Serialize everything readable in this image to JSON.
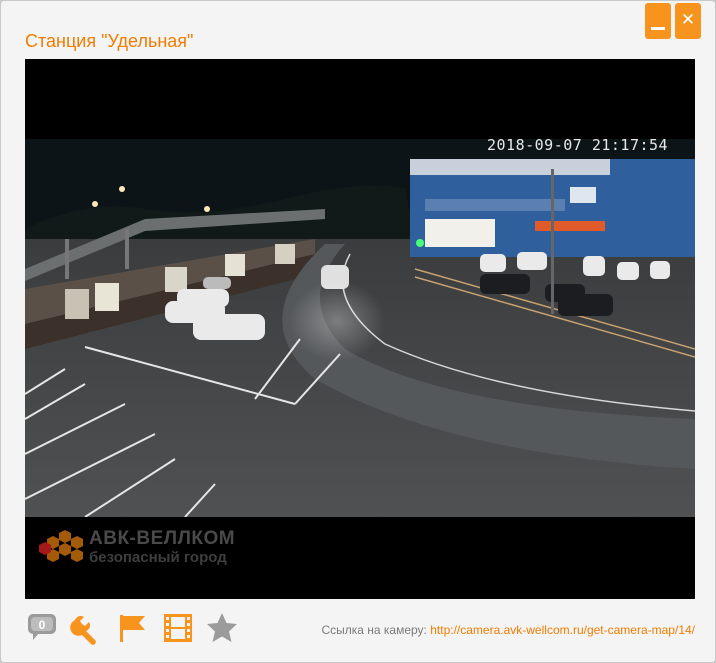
{
  "window": {
    "title": "Станция \"Удельная\"",
    "accent_color": "#f7941d",
    "title_color": "#f07c00",
    "buttons": [
      {
        "name": "minimize-icon"
      },
      {
        "name": "close-icon",
        "glyph": "✕"
      }
    ]
  },
  "video": {
    "timestamp": "2018-09-07 21:17:54",
    "watermark_name": "АВК-ВЕЛЛКОМ",
    "watermark_tagline": "безопасный город"
  },
  "toolbar": {
    "icons": [
      "comments-icon",
      "wrench-icon",
      "flag-icon",
      "film-icon",
      "star-icon"
    ],
    "comment_count": "0"
  },
  "footer": {
    "link_label": "Ссылка на камеру:",
    "link_url": "http://camera.avk-wellcom.ru/get-camera-map/14/"
  }
}
